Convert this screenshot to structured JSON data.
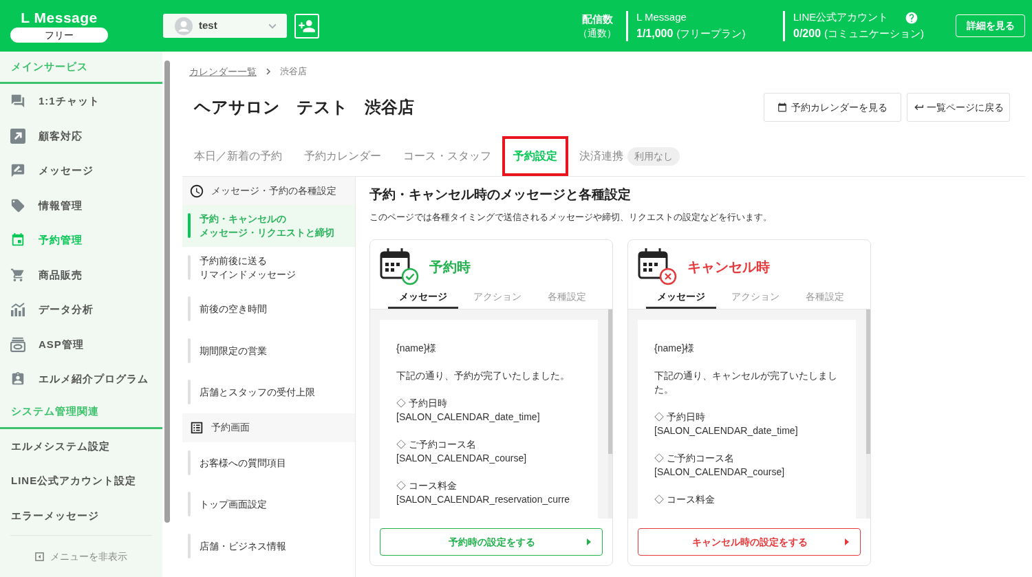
{
  "header": {
    "logo": "L Message",
    "plan": "フリー",
    "account": "test",
    "stats_title": "配信数",
    "stats_unit": "（通数）",
    "usage": [
      {
        "title": "L Message",
        "count": "1/1,000",
        "note": "(フリープラン)",
        "help": false
      },
      {
        "title": "LINE公式アカウント",
        "count": "0/200",
        "note": "(コミュニケーション)",
        "help": true
      }
    ],
    "details_button": "詳細を見る"
  },
  "sidebar": {
    "sections": [
      {
        "title": "メインサービス",
        "items": [
          {
            "label": "1:1チャット",
            "selected": false
          },
          {
            "label": "顧客対応",
            "selected": false
          },
          {
            "label": "メッセージ",
            "selected": false
          },
          {
            "label": "情報管理",
            "selected": false
          },
          {
            "label": "予約管理",
            "selected": true
          },
          {
            "label": "商品販売",
            "selected": false
          },
          {
            "label": "データ分析",
            "selected": false
          },
          {
            "label": "ASP管理",
            "selected": false
          },
          {
            "label": "エルメ紹介プログラム",
            "selected": false
          }
        ]
      },
      {
        "title": "システム管理関連",
        "items": [
          {
            "label": "エルメシステム設定",
            "selected": false
          },
          {
            "label": "LINE公式アカウント設定",
            "selected": false
          },
          {
            "label": "エラーメッセージ",
            "selected": false
          }
        ]
      }
    ],
    "hide_menu": "メニューを非表示"
  },
  "breadcrumb": [
    {
      "kind": "link",
      "label": "カレンダー一覧"
    },
    {
      "kind": "current",
      "label": "渋谷店"
    }
  ],
  "page_title": "ヘアサロン　テスト　渋谷店",
  "header_buttons": [
    "予約カレンダーを見る",
    "一覧ページに戻る"
  ],
  "tabs": [
    {
      "label": "本日／新着の予約",
      "selected": false,
      "highlighted": false
    },
    {
      "label": "予約カレンダー",
      "selected": false,
      "highlighted": false
    },
    {
      "label": "コース・スタッフ",
      "selected": false,
      "highlighted": false
    },
    {
      "label": "予約設定",
      "selected": true,
      "highlighted": true
    },
    {
      "label": "決済連携",
      "selected": false,
      "highlighted": false,
      "badge": "利用なし"
    }
  ],
  "settings_nav": [
    {
      "kind": "group",
      "label": "メッセージ・予約の各種設定"
    },
    {
      "kind": "item",
      "lines": [
        "予約・キャンセルの",
        "メッセージ・リクエストと締切"
      ],
      "selected": true
    },
    {
      "kind": "item",
      "lines": [
        "予約前後に送る",
        "リマインドメッセージ"
      ],
      "selected": false
    },
    {
      "kind": "item",
      "lines": [
        "前後の空き時間"
      ],
      "selected": false
    },
    {
      "kind": "item",
      "lines": [
        "期間限定の営業"
      ],
      "selected": false
    },
    {
      "kind": "item",
      "lines": [
        "店舗とスタッフの受付上限"
      ],
      "selected": false
    },
    {
      "kind": "group",
      "label": "予約画面"
    },
    {
      "kind": "item",
      "lines": [
        "お客様への質問項目"
      ],
      "selected": false
    },
    {
      "kind": "item",
      "lines": [
        "トップ画面設定"
      ],
      "selected": false
    },
    {
      "kind": "item",
      "lines": [
        "店舗・ビジネス情報"
      ],
      "selected": false
    }
  ],
  "section": {
    "title": "予約・キャンセル時のメッセージと各種設定",
    "description": "このページでは各種タイミングで送信されるメッセージや締切、リクエストの設定などを行います。"
  },
  "cards": [
    {
      "kind": "confirm",
      "title": "予約時",
      "color": "#22b14c",
      "tabs": [
        {
          "label": "メッセージ",
          "selected": true
        },
        {
          "label": "アクション",
          "selected": false
        },
        {
          "label": "各種設定",
          "selected": false
        }
      ],
      "message": [
        "{name}様",
        "下記の通り、予約が完了いたしました。",
        "◇ 予約日時\n[SALON_CALENDAR_date_time]",
        "◇ ご予約コース名\n[SALON_CALENDAR_course]",
        "◇ コース料金\n[SALON_CALENDAR_reservation_curre"
      ],
      "action": "予約時の設定をする"
    },
    {
      "kind": "cancel",
      "title": "キャンセル時",
      "color": "#e5393b",
      "tabs": [
        {
          "label": "メッセージ",
          "selected": true
        },
        {
          "label": "アクション",
          "selected": false
        },
        {
          "label": "各種設定",
          "selected": false
        }
      ],
      "message": [
        "{name}様",
        "下記の通り、キャンセルが完了いたしました。",
        "◇ 予約日時\n[SALON_CALENDAR_date_time]",
        "◇ ご予約コース名\n[SALON_CALENDAR_course]",
        "◇ コース料金"
      ],
      "action": "キャンセル時の設定をする"
    }
  ]
}
